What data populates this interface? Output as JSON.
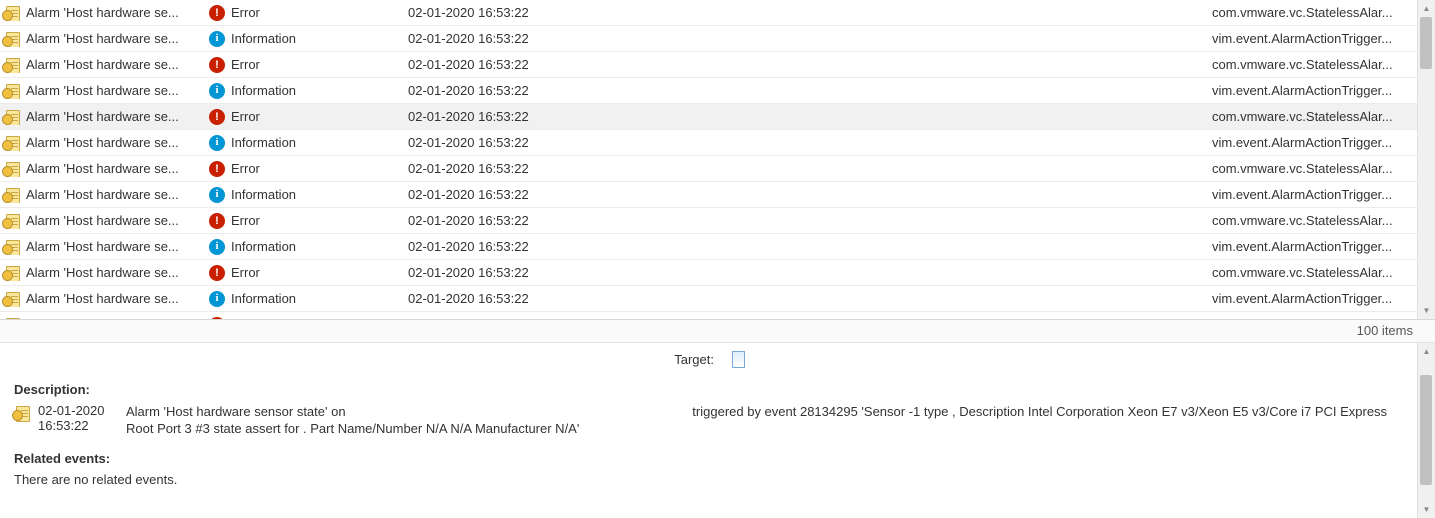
{
  "rows_description": "Alarm 'Host hardware se...",
  "rows_datetime": "02-01-2020 16:53:22",
  "type_error": "Error",
  "type_info": "Information",
  "eid_error": "com.vmware.vc.StatelessAlar...",
  "eid_info": "vim.event.AlarmActionTrigger...",
  "eid_error_cut": "com vmware vc StatelessAlar",
  "rows": [
    {
      "sel": false,
      "type": "error"
    },
    {
      "sel": false,
      "type": "info"
    },
    {
      "sel": false,
      "type": "error"
    },
    {
      "sel": false,
      "type": "info"
    },
    {
      "sel": true,
      "type": "error"
    },
    {
      "sel": false,
      "type": "info"
    },
    {
      "sel": false,
      "type": "error"
    },
    {
      "sel": false,
      "type": "info"
    },
    {
      "sel": false,
      "type": "error"
    },
    {
      "sel": false,
      "type": "info"
    },
    {
      "sel": false,
      "type": "error"
    },
    {
      "sel": false,
      "type": "info"
    },
    {
      "sel": false,
      "type": "error_cut"
    }
  ],
  "footer_count": "100 items",
  "detail": {
    "target_label": "Target:",
    "section_description": "Description:",
    "event_datetime": "02-01-2020 16:53:22",
    "event_text": "Alarm 'Host hardware sensor state' on                                                                                                triggered by event 28134295 'Sensor -1 type , Description Intel Corporation Xeon E7 v3/Xeon E5 v3/Core i7 PCI Express Root Port 3 #3 state assert for . Part Name/Number N/A N/A Manufacturer N/A'",
    "section_related": "Related events:",
    "no_related": "There are no related events."
  }
}
